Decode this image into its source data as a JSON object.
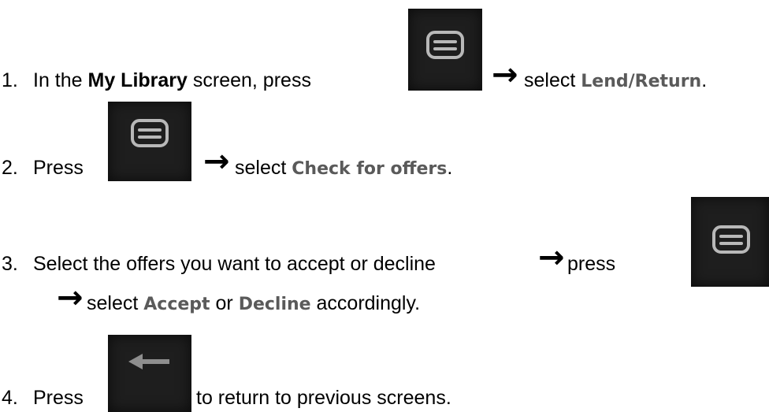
{
  "steps": [
    {
      "number": "1.",
      "part1": "In the ",
      "bold": "My Library",
      "part2": " screen, press ",
      "part3": " select ",
      "keyword": "Lend/Return",
      "end": "."
    },
    {
      "number": "2.",
      "part1": "Press ",
      "part2": " select ",
      "keyword": "Check for offers",
      "end": "."
    },
    {
      "number": "3.",
      "part1": "Select the offers you want to accept or decline ",
      "part2": " press",
      "part3": " select ",
      "keyword1": "Accept",
      "or": " or ",
      "keyword2": "Decline",
      "end": " accordingly."
    },
    {
      "number": "4.",
      "part1": "Press ",
      "part2": " to return to previous screens."
    }
  ],
  "icons": {
    "menu": "menu-icon",
    "back": "back-arrow-icon",
    "arrow": "right-arrow-icon"
  },
  "colors": {
    "keyword": "#5a5a5a",
    "button_bg": "#1e1e1e",
    "icon_stroke": "#b8b8b8"
  }
}
